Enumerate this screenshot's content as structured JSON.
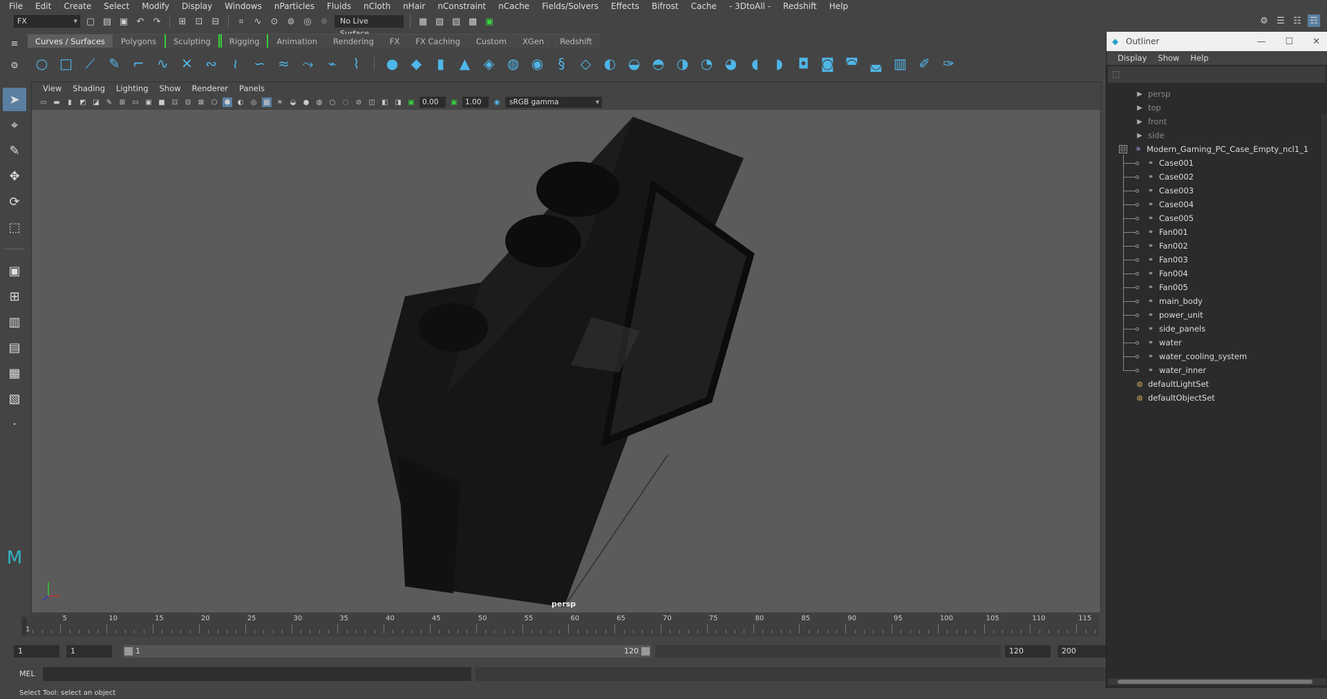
{
  "menubar": [
    "File",
    "Edit",
    "Create",
    "Select",
    "Modify",
    "Display",
    "Windows",
    "nParticles",
    "Fluids",
    "nCloth",
    "nHair",
    "nConstraint",
    "nCache",
    "Fields/Solvers",
    "Effects",
    "Bifrost",
    "Cache",
    "- 3DtoAll -",
    "Redshift",
    "Help"
  ],
  "statusline": {
    "mode": "FX",
    "live_surface": "No Live Surface"
  },
  "shelf_tabs": [
    "Curves / Surfaces",
    "Polygons",
    "Sculpting",
    "Rigging",
    "Animation",
    "Rendering",
    "FX",
    "FX Caching",
    "Custom",
    "XGen",
    "Redshift"
  ],
  "active_shelf_tab": "Curves / Surfaces",
  "viewport": {
    "menu": [
      "View",
      "Shading",
      "Lighting",
      "Show",
      "Renderer",
      "Panels"
    ],
    "exposure": "0.00",
    "gamma": "1.00",
    "color_space": "sRGB gamma",
    "camera_label": "persp"
  },
  "timeline": {
    "ticks": [
      "1",
      "5",
      "10",
      "15",
      "20",
      "25",
      "30",
      "35",
      "40",
      "45",
      "50",
      "55",
      "60",
      "65",
      "70",
      "75",
      "80",
      "85",
      "90",
      "95",
      "100",
      "105",
      "110",
      "115"
    ],
    "current_frame": "1"
  },
  "range": {
    "start": "1",
    "playback_start": "1",
    "slider_start": "1",
    "slider_end": "120",
    "playback_end": "120",
    "end": "200"
  },
  "mel": {
    "label": "MEL"
  },
  "help_line": "Select Tool: select an object",
  "outliner": {
    "title": "Outliner",
    "menu": [
      "Display",
      "Show",
      "Help"
    ],
    "cameras": [
      "persp",
      "top",
      "front",
      "side"
    ],
    "group": "Modern_Gaming_PC_Case_Empty_ncl1_1",
    "children": [
      "Case001",
      "Case002",
      "Case003",
      "Case004",
      "Case005",
      "Fan001",
      "Fan002",
      "Fan003",
      "Fan004",
      "Fan005",
      "main_body",
      "power_unit",
      "side_panels",
      "water",
      "water_cooling_system",
      "water_inner"
    ],
    "sets": [
      "defaultLightSet",
      "defaultObjectSet"
    ]
  },
  "colors": {
    "accent": "#4fb6e8",
    "selected_tool": "#5a7fa2",
    "green_marker": "#39d23f"
  }
}
